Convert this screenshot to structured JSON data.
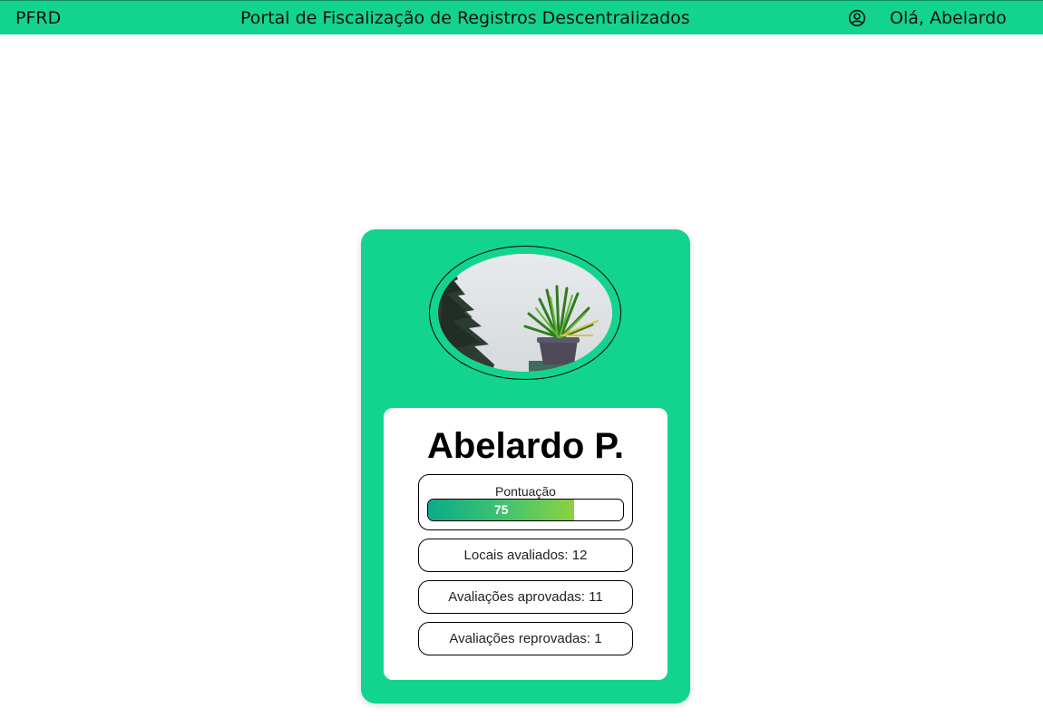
{
  "header": {
    "brand": "PFRD",
    "title": "Portal de Fiscalização de Registros Descentralizados",
    "user_icon": "user-circle-icon",
    "greeting": "Olá, Abelardo"
  },
  "profile": {
    "avatar": "plant-photo",
    "name": "Abelardo P.",
    "score": {
      "label": "Pontuação",
      "value": "75",
      "percent": 75
    },
    "stats": [
      "Locais avaliados: 12",
      "Avaliações aprovadas: 11",
      "Avaliações reprovadas: 1"
    ]
  },
  "colors": {
    "accent": "#12d48e",
    "progress_start": "#0aab8a",
    "progress_end": "#8ed13f"
  }
}
